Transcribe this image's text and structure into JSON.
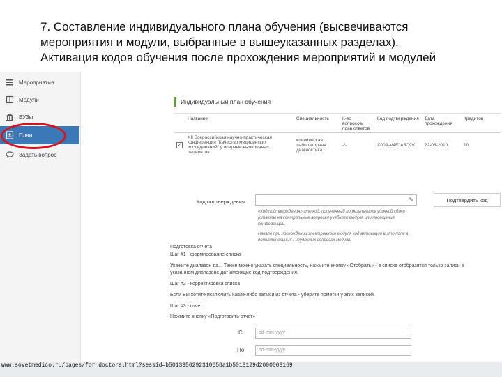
{
  "heading": {
    "line1": "7. Составление индивидуального плана обучения (высвечиваются",
    "line2": "мероприятия и модули, выбранные в вышеуказанных разделах).",
    "line3": "Активация кодов обучения после прохождения мероприятий и модулей"
  },
  "sidebar": {
    "items": [
      {
        "label": "Мероприятия",
        "icon": "list-icon"
      },
      {
        "label": "Модули",
        "icon": "book-icon"
      },
      {
        "label": "ВУЗы",
        "icon": "institution-icon"
      },
      {
        "label": "План",
        "icon": "plan-icon",
        "active": true
      },
      {
        "label": "Задать вопрос",
        "icon": "chat-icon"
      }
    ],
    "highlight_color": "#d7141a",
    "active_color": "#3a78b8"
  },
  "plan": {
    "title": "Индивидуальный план обучения",
    "columns": [
      "Название",
      "Специальность",
      "К-во вопросов/ прав ответов",
      "Код подтверждения",
      "Дата прохождения",
      "Кредитов"
    ],
    "rows": [
      {
        "checked": true,
        "name": "XII Всероссийская научно-практическая конференция \"Качество медицинских исследований\" у впервые выявленных пациентов",
        "specialty": "клиническая лабораторная диагностика",
        "answers": "-/-",
        "code": "X00A-V4FJA5C9V",
        "date": "22-08-2010",
        "credits": "10"
      }
    ]
  },
  "code_section": {
    "label": "Код подтверждения",
    "input_value": "",
    "confirm_button": "Подтвердить код",
    "note1": "«Код подтверждения» это код, полученный по результату удачной сдачи (ответы на контрольные вопросы) учебного модуля или посещения конференции.",
    "note2": "Начало при прохождении электронного модуля код активации в это поле в дополнительных / неудачных вопросах модуля."
  },
  "report": {
    "title": "Подготовка отчета",
    "step1": "Шаг #1 - формирование списка",
    "step1_text": "Укажите диапазон да... Также можно указать специальность, нажмите кнопку «Отобрать» - в списке отобразятся только записи в",
    "step1_text2": "указанном диапазоне дат имеющие код подтверждения.",
    "step2": "Шаг #2 - корректировка списка",
    "step2_text": "Если Вы хотите исключить какие-либо записи из отчета - уберите пометки у этих записей.",
    "step3": "Шаг #3 - отчет",
    "step3_text": "Нажмите кнопку «Подготовить отчет»",
    "from_label": "С",
    "to_label": "По",
    "date_placeholder": "dd-mm-yyyy"
  },
  "statusbar": {
    "url": "www.sovetmedico.ru/pages/for_doctors.html?sessid=b5013350292310658a1b5013129d2000003169"
  }
}
